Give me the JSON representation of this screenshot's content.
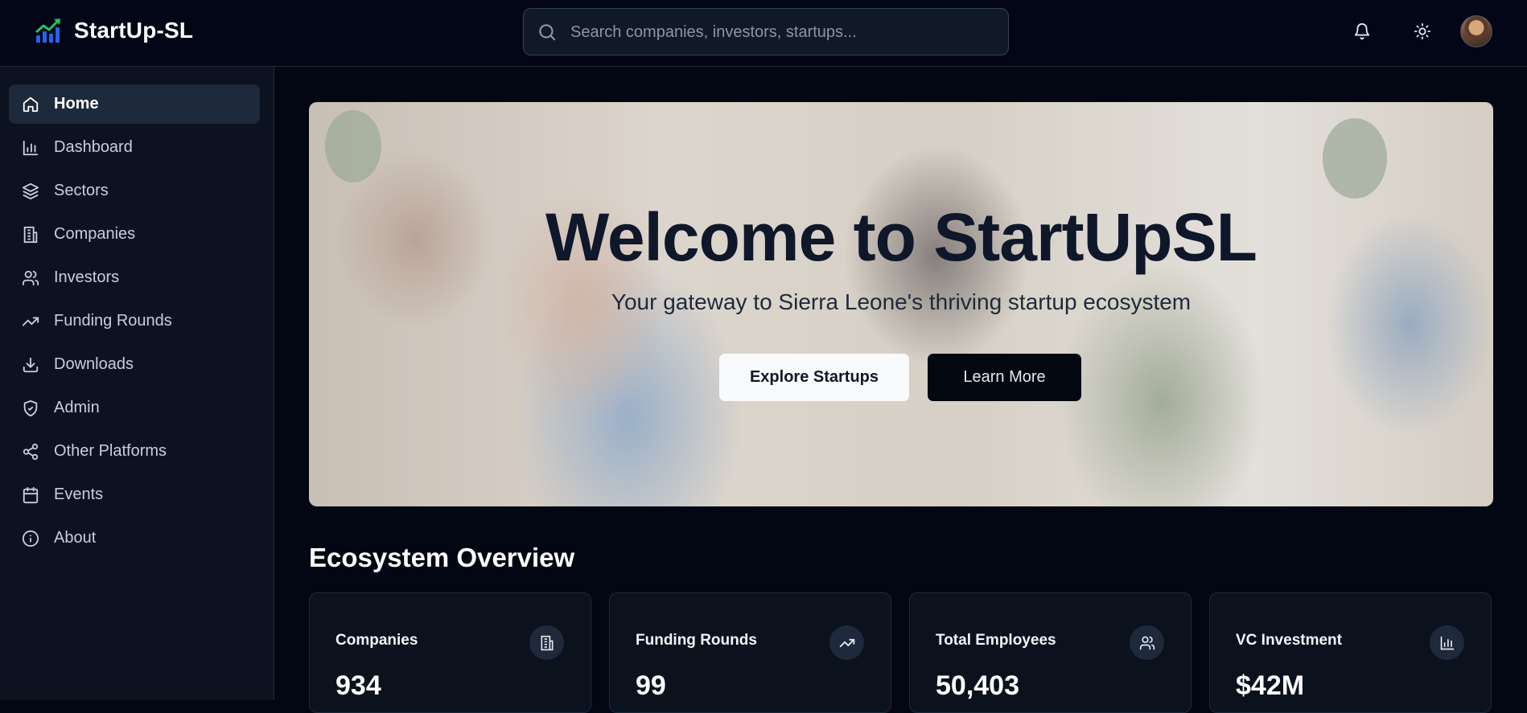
{
  "header": {
    "brand": "StartUp-SL",
    "search_placeholder": "Search companies, investors, startups...",
    "icons": [
      "bell-icon",
      "sun-icon",
      "avatar"
    ]
  },
  "sidebar": {
    "items": [
      {
        "label": "Home",
        "icon": "home-icon",
        "active": true
      },
      {
        "label": "Dashboard",
        "icon": "bar-chart-icon"
      },
      {
        "label": "Sectors",
        "icon": "layers-icon"
      },
      {
        "label": "Companies",
        "icon": "building-icon"
      },
      {
        "label": "Investors",
        "icon": "users-icon"
      },
      {
        "label": "Funding Rounds",
        "icon": "trending-up-icon"
      },
      {
        "label": "Downloads",
        "icon": "download-icon"
      },
      {
        "label": "Admin",
        "icon": "shield-icon"
      },
      {
        "label": "Other Platforms",
        "icon": "share-icon"
      },
      {
        "label": "Events",
        "icon": "calendar-icon"
      },
      {
        "label": "About",
        "icon": "info-icon"
      }
    ]
  },
  "hero": {
    "title": "Welcome to StartUpSL",
    "subtitle": "Your gateway to Sierra Leone's thriving startup ecosystem",
    "primary_button": "Explore Startups",
    "secondary_button": "Learn More"
  },
  "overview": {
    "title": "Ecosystem Overview",
    "cards": [
      {
        "label": "Companies",
        "value": "934",
        "icon": "building-icon"
      },
      {
        "label": "Funding Rounds",
        "value": "99",
        "icon": "trending-up-icon"
      },
      {
        "label": "Total Employees",
        "value": "50,403",
        "icon": "users-icon"
      },
      {
        "label": "VC Investment",
        "value": "$42M",
        "icon": "bar-chart-icon"
      }
    ]
  },
  "colors": {
    "background": "#030713",
    "sidebar": "#0c1220",
    "active_item": "#1e293b",
    "brand_green": "#22c55e",
    "brand_blue": "#2563eb"
  }
}
